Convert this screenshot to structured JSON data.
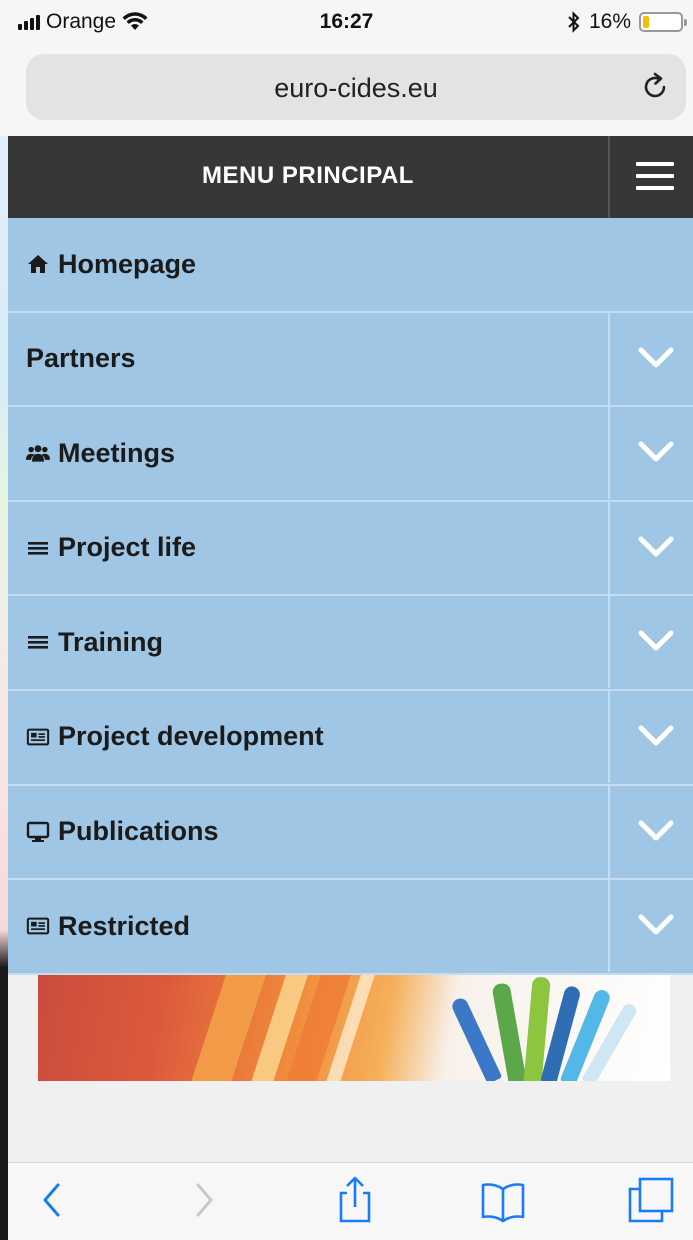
{
  "status_bar": {
    "carrier": "Orange",
    "time": "16:27",
    "battery_percent": "16%",
    "battery_level": 0.16,
    "icons": [
      "signal-icon",
      "wifi-icon",
      "bluetooth-icon",
      "battery-icon"
    ]
  },
  "browser": {
    "url": "euro-cides.eu",
    "reload_icon": "reload-icon"
  },
  "menu": {
    "title": "MENU PRINCIPAL",
    "toggle_icon": "hamburger-icon",
    "items": [
      {
        "label": "Homepage",
        "icon": "home-icon",
        "has_submenu": false
      },
      {
        "label": "Partners",
        "icon": "",
        "has_submenu": true
      },
      {
        "label": "Meetings",
        "icon": "users-icon",
        "has_submenu": true
      },
      {
        "label": "Project life",
        "icon": "list-icon",
        "has_submenu": true
      },
      {
        "label": "Training",
        "icon": "list-icon",
        "has_submenu": true
      },
      {
        "label": "Project development",
        "icon": "newspaper-icon",
        "has_submenu": true
      },
      {
        "label": "Publications",
        "icon": "desktop-icon",
        "has_submenu": true
      },
      {
        "label": "Restricted",
        "icon": "newspaper-icon",
        "has_submenu": true
      }
    ]
  },
  "toolbar": {
    "icons": [
      "back-icon",
      "forward-icon",
      "share-icon",
      "bookmarks-icon",
      "tabs-icon"
    ]
  },
  "colors": {
    "menu_header": "#373737",
    "menu_item": "#a0c6e6",
    "accent_ios_blue": "#1a7cf5"
  }
}
